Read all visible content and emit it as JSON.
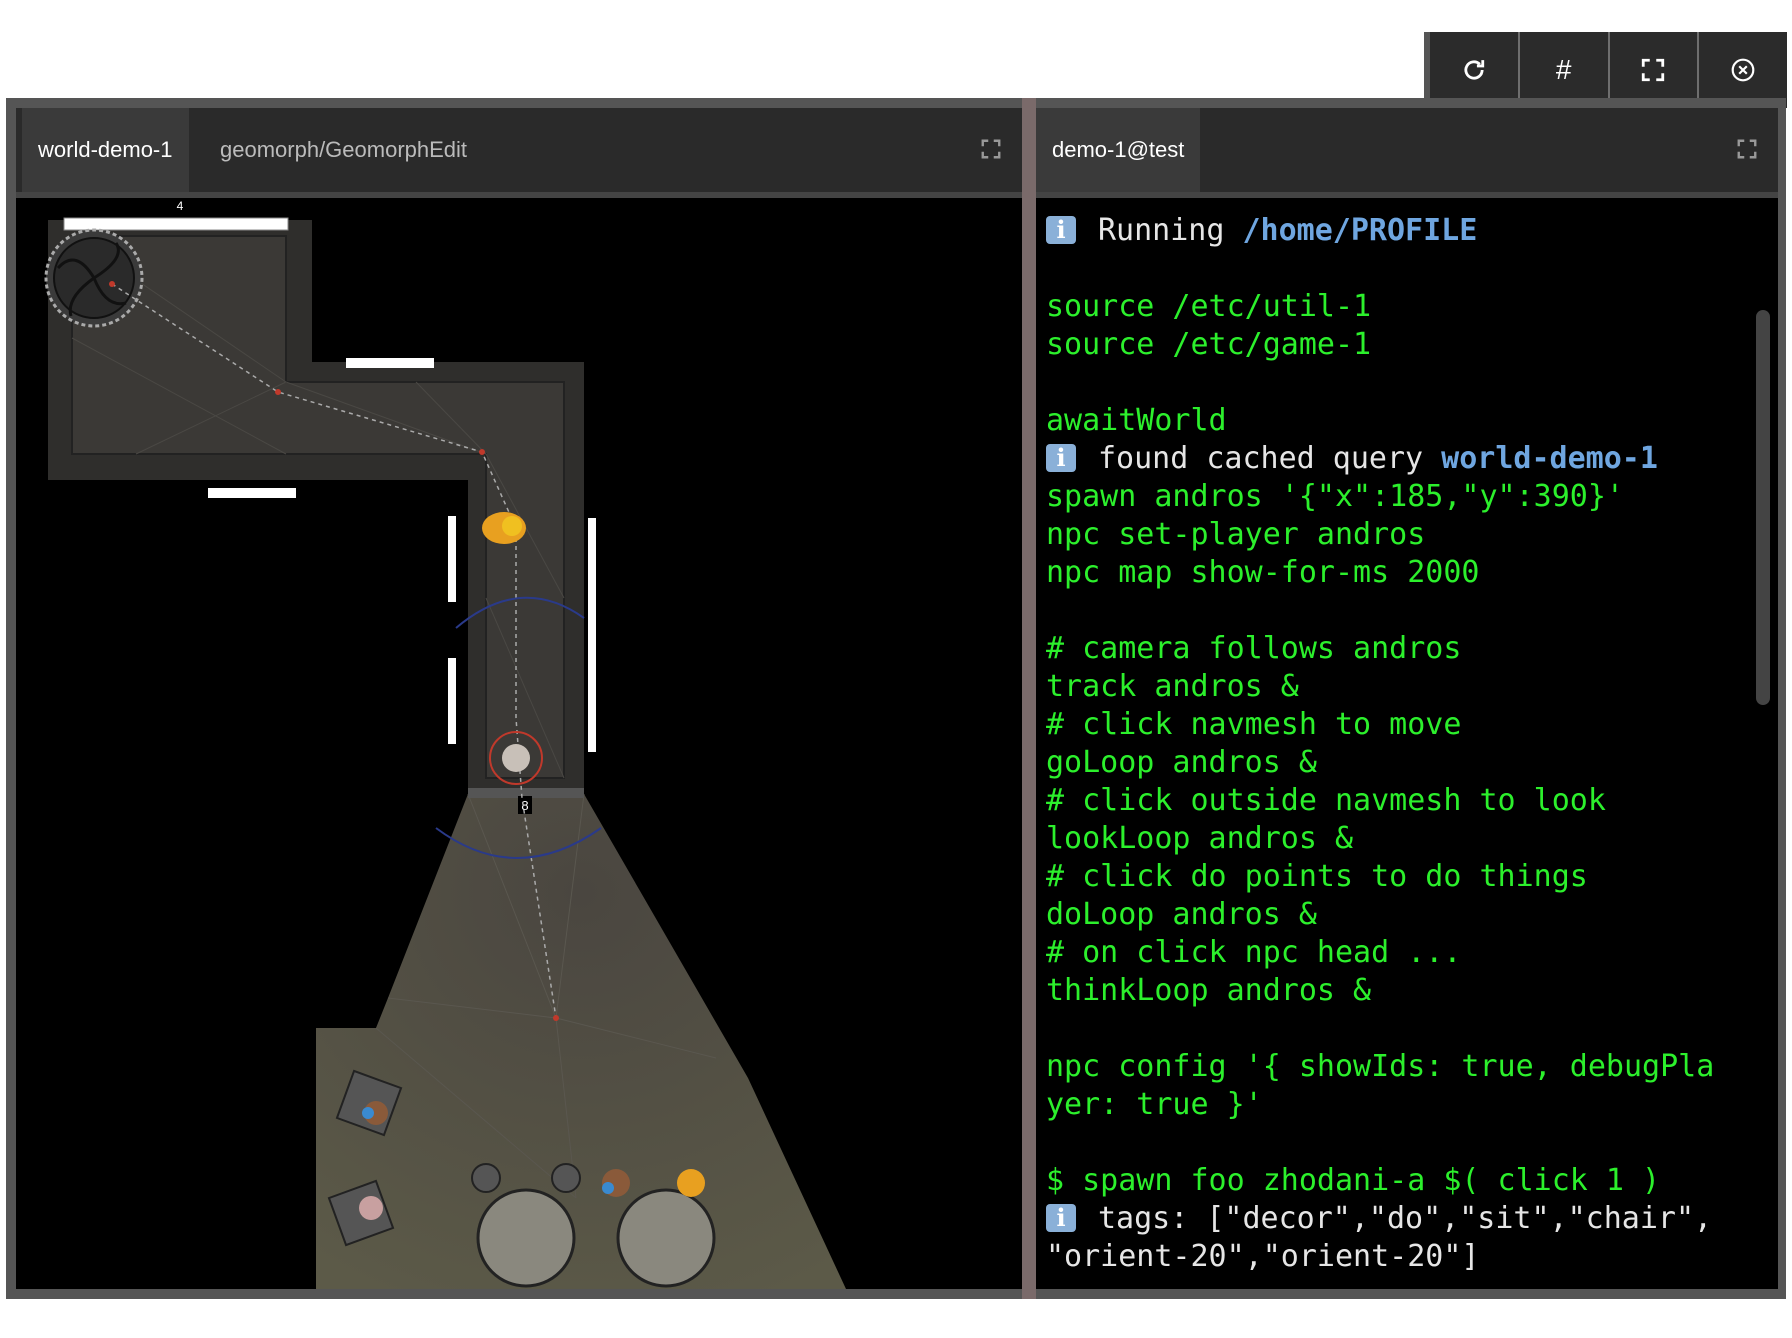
{
  "controls": {
    "refresh_icon": "refresh-icon",
    "grid_label": "#",
    "fullscreen_icon": "fullscreen-icon",
    "close_icon": "close-icon"
  },
  "left_panel": {
    "tabs": [
      {
        "label": "world-demo-1",
        "active": true
      },
      {
        "label": "geomorph/GeomorphEdit",
        "active": false
      }
    ],
    "map": {
      "door_label_top": "4",
      "door_label_bottom": "8"
    }
  },
  "right_panel": {
    "tabs": [
      {
        "label": "demo-1@test",
        "active": true
      }
    ],
    "terminal": {
      "running_text": "Running ",
      "running_path": "/home/PROFILE",
      "lines1": [
        "source /etc/util-1",
        "source /etc/game-1"
      ],
      "await": "awaitWorld",
      "cached_text": "found cached query ",
      "cached_name": "world-demo-1",
      "lines2": [
        "spawn andros '{\"x\":185,\"y\":390}'",
        "npc set-player andros",
        "npc map show-for-ms 2000"
      ],
      "lines3": [
        "# camera follows andros",
        "track andros &",
        "# click navmesh to move",
        "goLoop andros &",
        "# click outside navmesh to look",
        "lookLoop andros &",
        "# click do points to do things",
        "doLoop andros &",
        "# on click npc head ...",
        "thinkLoop andros &"
      ],
      "lines4": [
        "npc config '{ showIds: true, debugPla",
        "yer: true }'"
      ],
      "prompt_line": "$ spawn foo zhodani-a $( click 1 )",
      "tags_line1": "tags: [\"decor\",\"do\",\"sit\",\"chair\",",
      "tags_line2": "\"orient-20\",\"orient-20\"]"
    }
  },
  "colors": {
    "terminal_green": "#2cf02c",
    "highlight_blue": "#6fa6e0",
    "tab_bar": "#2a2a2a",
    "frame": "#555555"
  }
}
